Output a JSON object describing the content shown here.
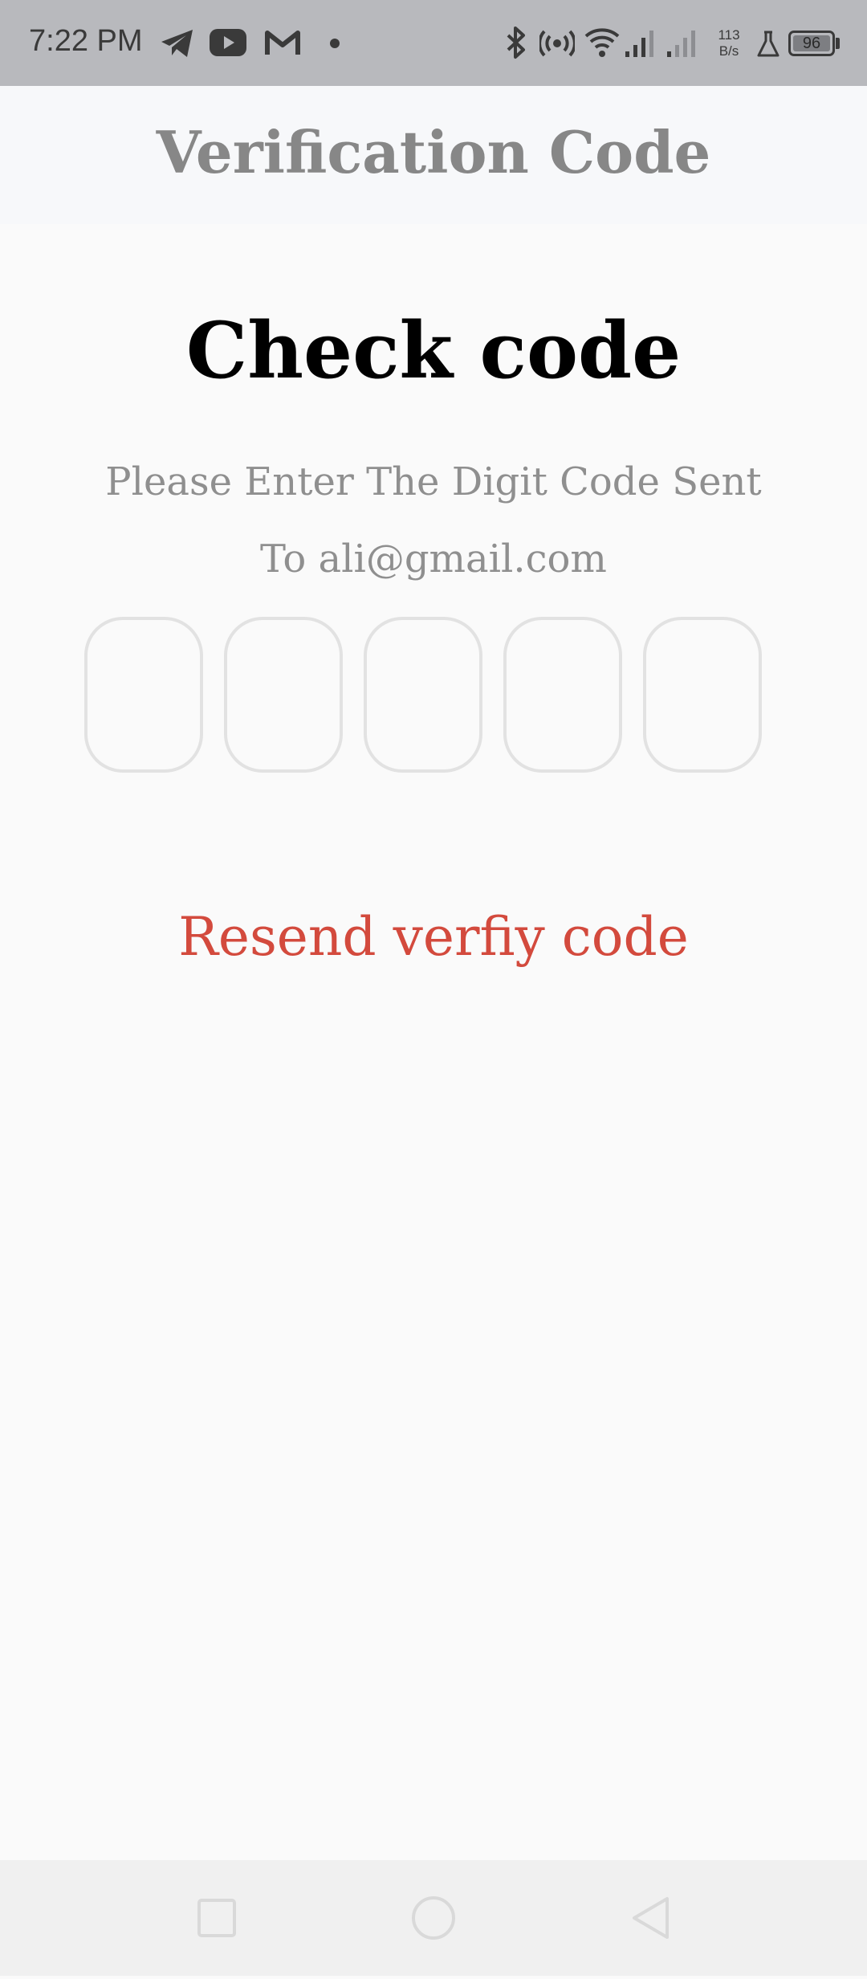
{
  "status_bar": {
    "time": "7:22 PM",
    "notification_icons": [
      "telegram-icon",
      "youtube-icon",
      "gmail-icon",
      "dot-icon"
    ],
    "system_icons": [
      "bluetooth-icon",
      "hotspot-icon",
      "wifi-icon",
      "signal-icon",
      "signal-icon",
      "flask-icon",
      "battery-icon"
    ],
    "net_speed_value": "113",
    "net_speed_unit": "B/s",
    "battery_level": "96"
  },
  "app_bar": {
    "title": "Verification Code"
  },
  "main": {
    "heading": "Check code",
    "instruction_line1": "Please Enter The Digit Code Sent",
    "instruction_line2": "To ali@gmail.com",
    "code_boxes": [
      "",
      "",
      "",
      "",
      ""
    ],
    "resend_label": "Resend verfiy code"
  },
  "nav_bar": {
    "buttons": [
      "recents-square-icon",
      "home-circle-icon",
      "back-triangle-icon"
    ]
  },
  "colors": {
    "status_bar_bg": "#b8b9bd",
    "app_bar_bg": "#f7f8fa",
    "page_bg": "#fafafa",
    "title_gray": "#878787",
    "resend_red": "#d34a3d",
    "box_border": "#e2e2e2"
  }
}
